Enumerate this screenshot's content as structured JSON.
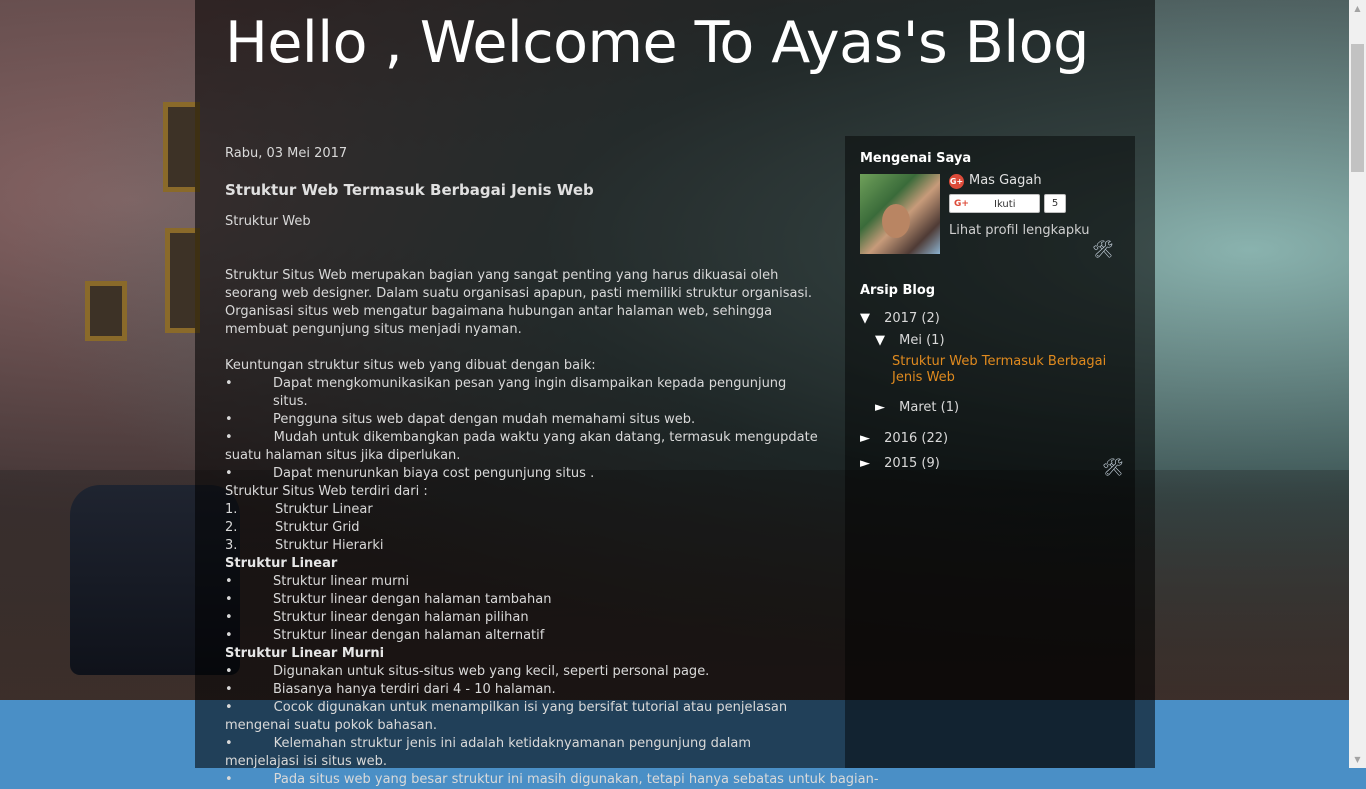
{
  "blog": {
    "title": "Hello , Welcome To Ayas's Blog"
  },
  "post": {
    "date": "Rabu, 03 Mei 2017",
    "title": "Struktur Web Termasuk Berbagai Jenis Web",
    "subtitle": "Struktur Web",
    "intro": "Struktur Situs Web merupakan bagian yang sangat penting yang harus dikuasai oleh seorang web designer. Dalam suatu organisasi apapun, pasti memiliki struktur organisasi. Organisasi situs web mengatur bagaimana hubungan antar halaman web, sehingga membuat pengunjung situs menjadi nyaman.",
    "benefits_heading": "Keuntungan struktur situs web yang dibuat dengan baik:",
    "bullet": "•",
    "benefits": [
      "Dapat mengkomunikasikan pesan yang ingin disampaikan kepada pengunjung situs.",
      "Pengguna situs web dapat dengan mudah memahami situs web.",
      "Mudah untuk dikembangkan pada waktu yang akan datang, termasuk mengupdate suatu halaman situs jika diperlukan.",
      "Dapat menurunkan biaya cost pengunjung situs ."
    ],
    "types_heading": "Struktur Situs Web terdiri dari :",
    "types": [
      {
        "num": "1.",
        "text": "Struktur Linear"
      },
      {
        "num": "2.",
        "text": "Struktur Grid"
      },
      {
        "num": "3.",
        "text": "Struktur Hierarki"
      }
    ],
    "linear_heading": "Struktur Linear",
    "linear_items": [
      "Struktur linear murni",
      "Struktur linear dengan halaman tambahan",
      "Struktur linear dengan halaman pilihan",
      "Struktur linear dengan halaman alternatif"
    ],
    "pure_heading": "Struktur Linear Murni",
    "pure_items": [
      "Digunakan untuk situs-situs web yang kecil, seperti personal page.",
      "Biasanya hanya terdiri dari 4 - 10 halaman.",
      "Cocok digunakan untuk menampilkan isi yang bersifat tutorial atau penjelasan mengenai suatu pokok bahasan.",
      "Kelemahan struktur jenis ini adalah ketidaknyamanan pengunjung dalam menjelajasi isi situs web.",
      "Pada situs web yang besar struktur ini masih digunakan, tetapi hanya sebatas untuk bagian-"
    ]
  },
  "sidebar": {
    "about_title": "Mengenai Saya",
    "profile_name": "Mas Gagah",
    "gplus_glyph": "G+",
    "follow_label": "Ikuti",
    "follow_count": "5",
    "profile_link": "Lihat profil lengkapku",
    "archive_title": "Arsip Blog",
    "archive": {
      "y2017": {
        "toggle": "▼",
        "label": "2017",
        "count": "(2)"
      },
      "mei": {
        "toggle": "▼",
        "label": "Mei",
        "count": "(1)"
      },
      "mei_post": "Struktur Web Termasuk Berbagai Jenis Web",
      "maret": {
        "toggle": "►",
        "label": "Maret",
        "count": "(1)"
      },
      "y2016": {
        "toggle": "►",
        "label": "2016",
        "count": "(22)"
      },
      "y2015": {
        "toggle": "►",
        "label": "2015",
        "count": "(9)"
      }
    }
  },
  "icons": {
    "tool": "🛠",
    "scroll_up": "▲",
    "scroll_down": "▼"
  },
  "colors": {
    "link": "#e08a1e",
    "bottom_band": "#4a8fc6",
    "gplus_red": "#dd4b39"
  }
}
